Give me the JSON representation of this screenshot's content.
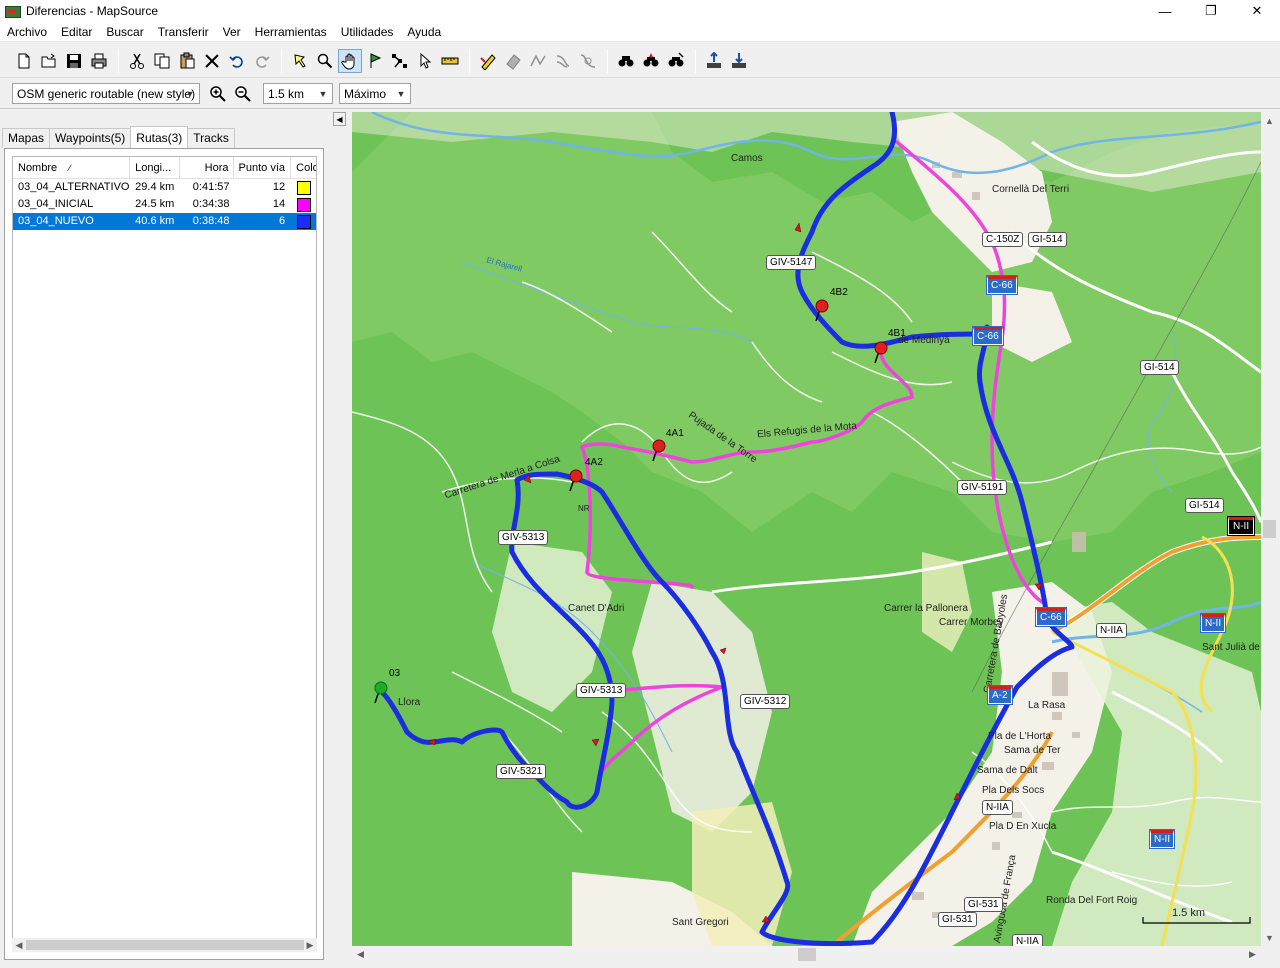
{
  "window": {
    "title": "Diferencias - MapSource",
    "minimize": "—",
    "maximize": "❐",
    "close": "✕"
  },
  "menu": [
    "Archivo",
    "Editar",
    "Buscar",
    "Transferir",
    "Ver",
    "Herramientas",
    "Utilidades",
    "Ayuda"
  ],
  "toolbar2": {
    "map_product": "OSM generic routable (new style)",
    "zoom_scale": "1.5 km",
    "detail": "Máximo"
  },
  "tabs": [
    {
      "label": "Mapas",
      "active": false
    },
    {
      "label": "Waypoints(5)",
      "active": false
    },
    {
      "label": "Rutas(3)",
      "active": true
    },
    {
      "label": "Tracks",
      "active": false
    }
  ],
  "routes_table": {
    "headers": [
      "Nombre",
      "Longi...",
      "Hora",
      "Punto vía",
      "Color"
    ],
    "sort_marker": "⁄",
    "rows": [
      {
        "name": "03_04_ALTERNATIVO",
        "length": "29.4 km",
        "time": "0:41:57",
        "points": "12",
        "color": "#ffff00",
        "selected": false
      },
      {
        "name": "03_04_INICIAL",
        "length": "24.5 km",
        "time": "0:34:38",
        "points": "14",
        "color": "#ff00ff",
        "selected": false
      },
      {
        "name": "03_04_NUEVO",
        "length": "40.6 km",
        "time": "0:38:48",
        "points": "6",
        "color": "#1a2cff",
        "selected": true
      }
    ]
  },
  "map": {
    "scale_label": "1.5 km",
    "place_labels": {
      "camos": "Camos",
      "cornella": "Cornellà Del Terri",
      "refugis": "Els Refugis de la Mota",
      "pujada": "Pujada de la Torre",
      "carretera_merla": "Carretera de Merla a Colsa",
      "canet": "Canet D'Adri",
      "llora": "Llora",
      "pallonera": "Carrer la Pallonera",
      "morbey": "Carrer Morbey",
      "rasa": "La Rasa",
      "pla_horta": "Pla de L'Horta",
      "sama_ter": "Sama de Ter",
      "sama_dalt": "Sama de Dalt",
      "pla_socs": "Pla Dels Socs",
      "pla_xucla": "Pla D En Xucla",
      "fort_roig": "Ronda Del Fort Roig",
      "sant_gregori": "Sant Gregori",
      "sant_julia": "Sant Julià de",
      "banyoles_road": "Carretera de Banyoles",
      "franca": "Avinguda de França",
      "medinyà": "de Medinyà",
      "riu": "El Rajarell",
      "nr": "NR"
    },
    "road_shields": {
      "c150z": "C-150Z",
      "gi514_a": "GI-514",
      "gi514_b": "GI-514",
      "gi514_c": "GI-514",
      "giv5147": "GIV-5147",
      "c66_a": "C-66",
      "c66_b": "C-66",
      "giv5191": "GIV-5191",
      "giv5313_a": "GIV-5313",
      "giv5313_b": "GIV-5313",
      "giv5312": "GIV-5312",
      "giv5321": "GIV-5321",
      "nii_black": "N-II",
      "nii_a": "N-II",
      "nii_b": "N-II",
      "niia_a": "N-IIA",
      "niia_b": "N-IIA",
      "niia_c": "N-IIA",
      "gi531_a": "GI-531",
      "gi531_b": "GI-531",
      "a2": "A-2",
      "c66_c": "C-66"
    },
    "waypoints": [
      {
        "label": "4B2",
        "type": "red"
      },
      {
        "label": "4B1",
        "type": "red"
      },
      {
        "label": "4A1",
        "type": "red"
      },
      {
        "label": "4A2",
        "type": "red"
      },
      {
        "label": "03",
        "type": "green"
      }
    ]
  }
}
